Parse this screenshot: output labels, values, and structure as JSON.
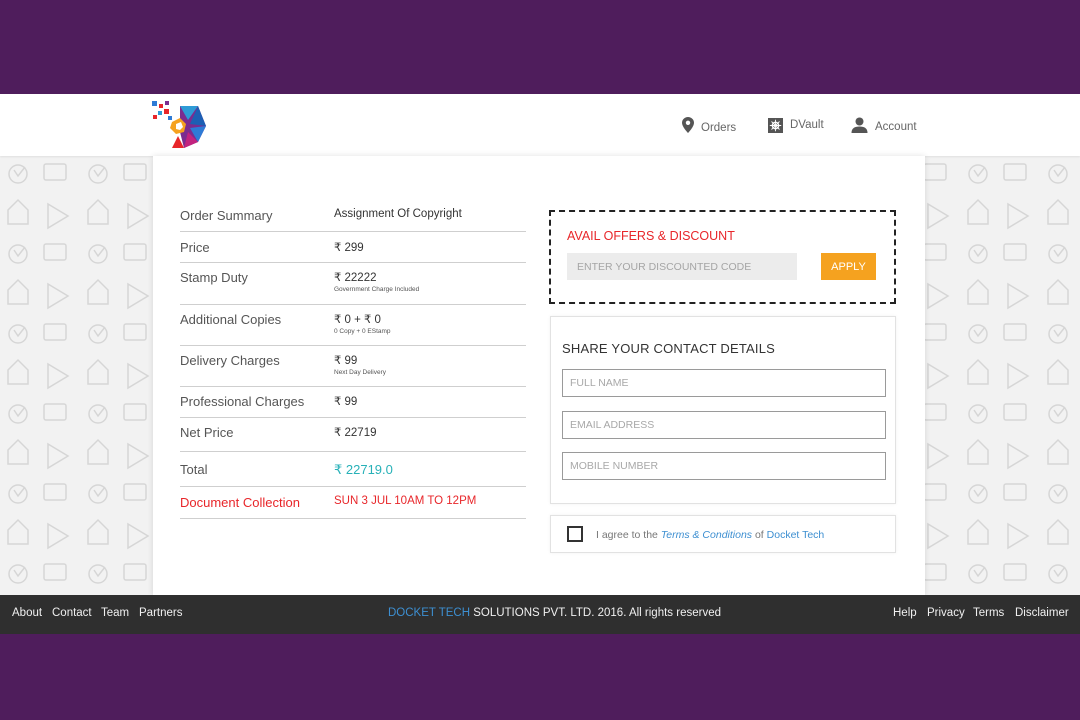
{
  "nav": {
    "orders": "Orders",
    "dvault": "DVault",
    "account": "Account"
  },
  "summary": {
    "header_label": "Order Summary",
    "header_value": "Assignment Of Copyright",
    "price_label": "Price",
    "price_value": "₹ 299",
    "stamp_label": "Stamp Duty",
    "stamp_value": "₹ 22222",
    "stamp_note": "Government Charge Included",
    "copies_label": "Additional Copies",
    "copies_value": "₹ 0 + ₹ 0",
    "copies_note": "0 Copy + 0 EStamp",
    "delivery_label": "Delivery Charges",
    "delivery_value": "₹ 99",
    "delivery_note": "Next Day Delivery",
    "professional_label": "Professional Charges",
    "professional_value": "₹ 99",
    "net_label": "Net Price",
    "net_value": "₹ 22719",
    "total_label": "Total",
    "total_value": "₹ 22719.0",
    "collection_label": "Document Collection",
    "collection_value": "SUN 3 JUL 10AM TO 12PM"
  },
  "offers": {
    "title": "AVAIL OFFERS & DISCOUNT",
    "placeholder": "ENTER YOUR DISCOUNTED CODE",
    "apply": "APPLY"
  },
  "contact": {
    "title": "SHARE YOUR CONTACT DETAILS",
    "name_placeholder": "FULL NAME",
    "email_placeholder": "EMAIL ADDRESS",
    "mobile_placeholder": "MOBILE NUMBER"
  },
  "agree": {
    "prefix": "I agree to the",
    "terms": "Terms & Conditions",
    "of": "of",
    "company": "Docket Tech"
  },
  "footer": {
    "about": "About",
    "contact": "Contact",
    "team": "Team",
    "partners": "Partners",
    "brand": "DOCKET TECH",
    "copyright": "SOLUTIONS PVT. LTD. 2016. All rights reserved",
    "help": "Help",
    "privacy": "Privacy",
    "terms": "Terms",
    "disclaimer": "Disclaimer"
  },
  "colors": {
    "frame": "#4f1d5c",
    "accent_red": "#e8262a",
    "accent_teal": "#27b1b8",
    "apply_orange": "#f5a21f",
    "link_blue": "#3d8fd1",
    "footer": "#2f2f2f"
  }
}
